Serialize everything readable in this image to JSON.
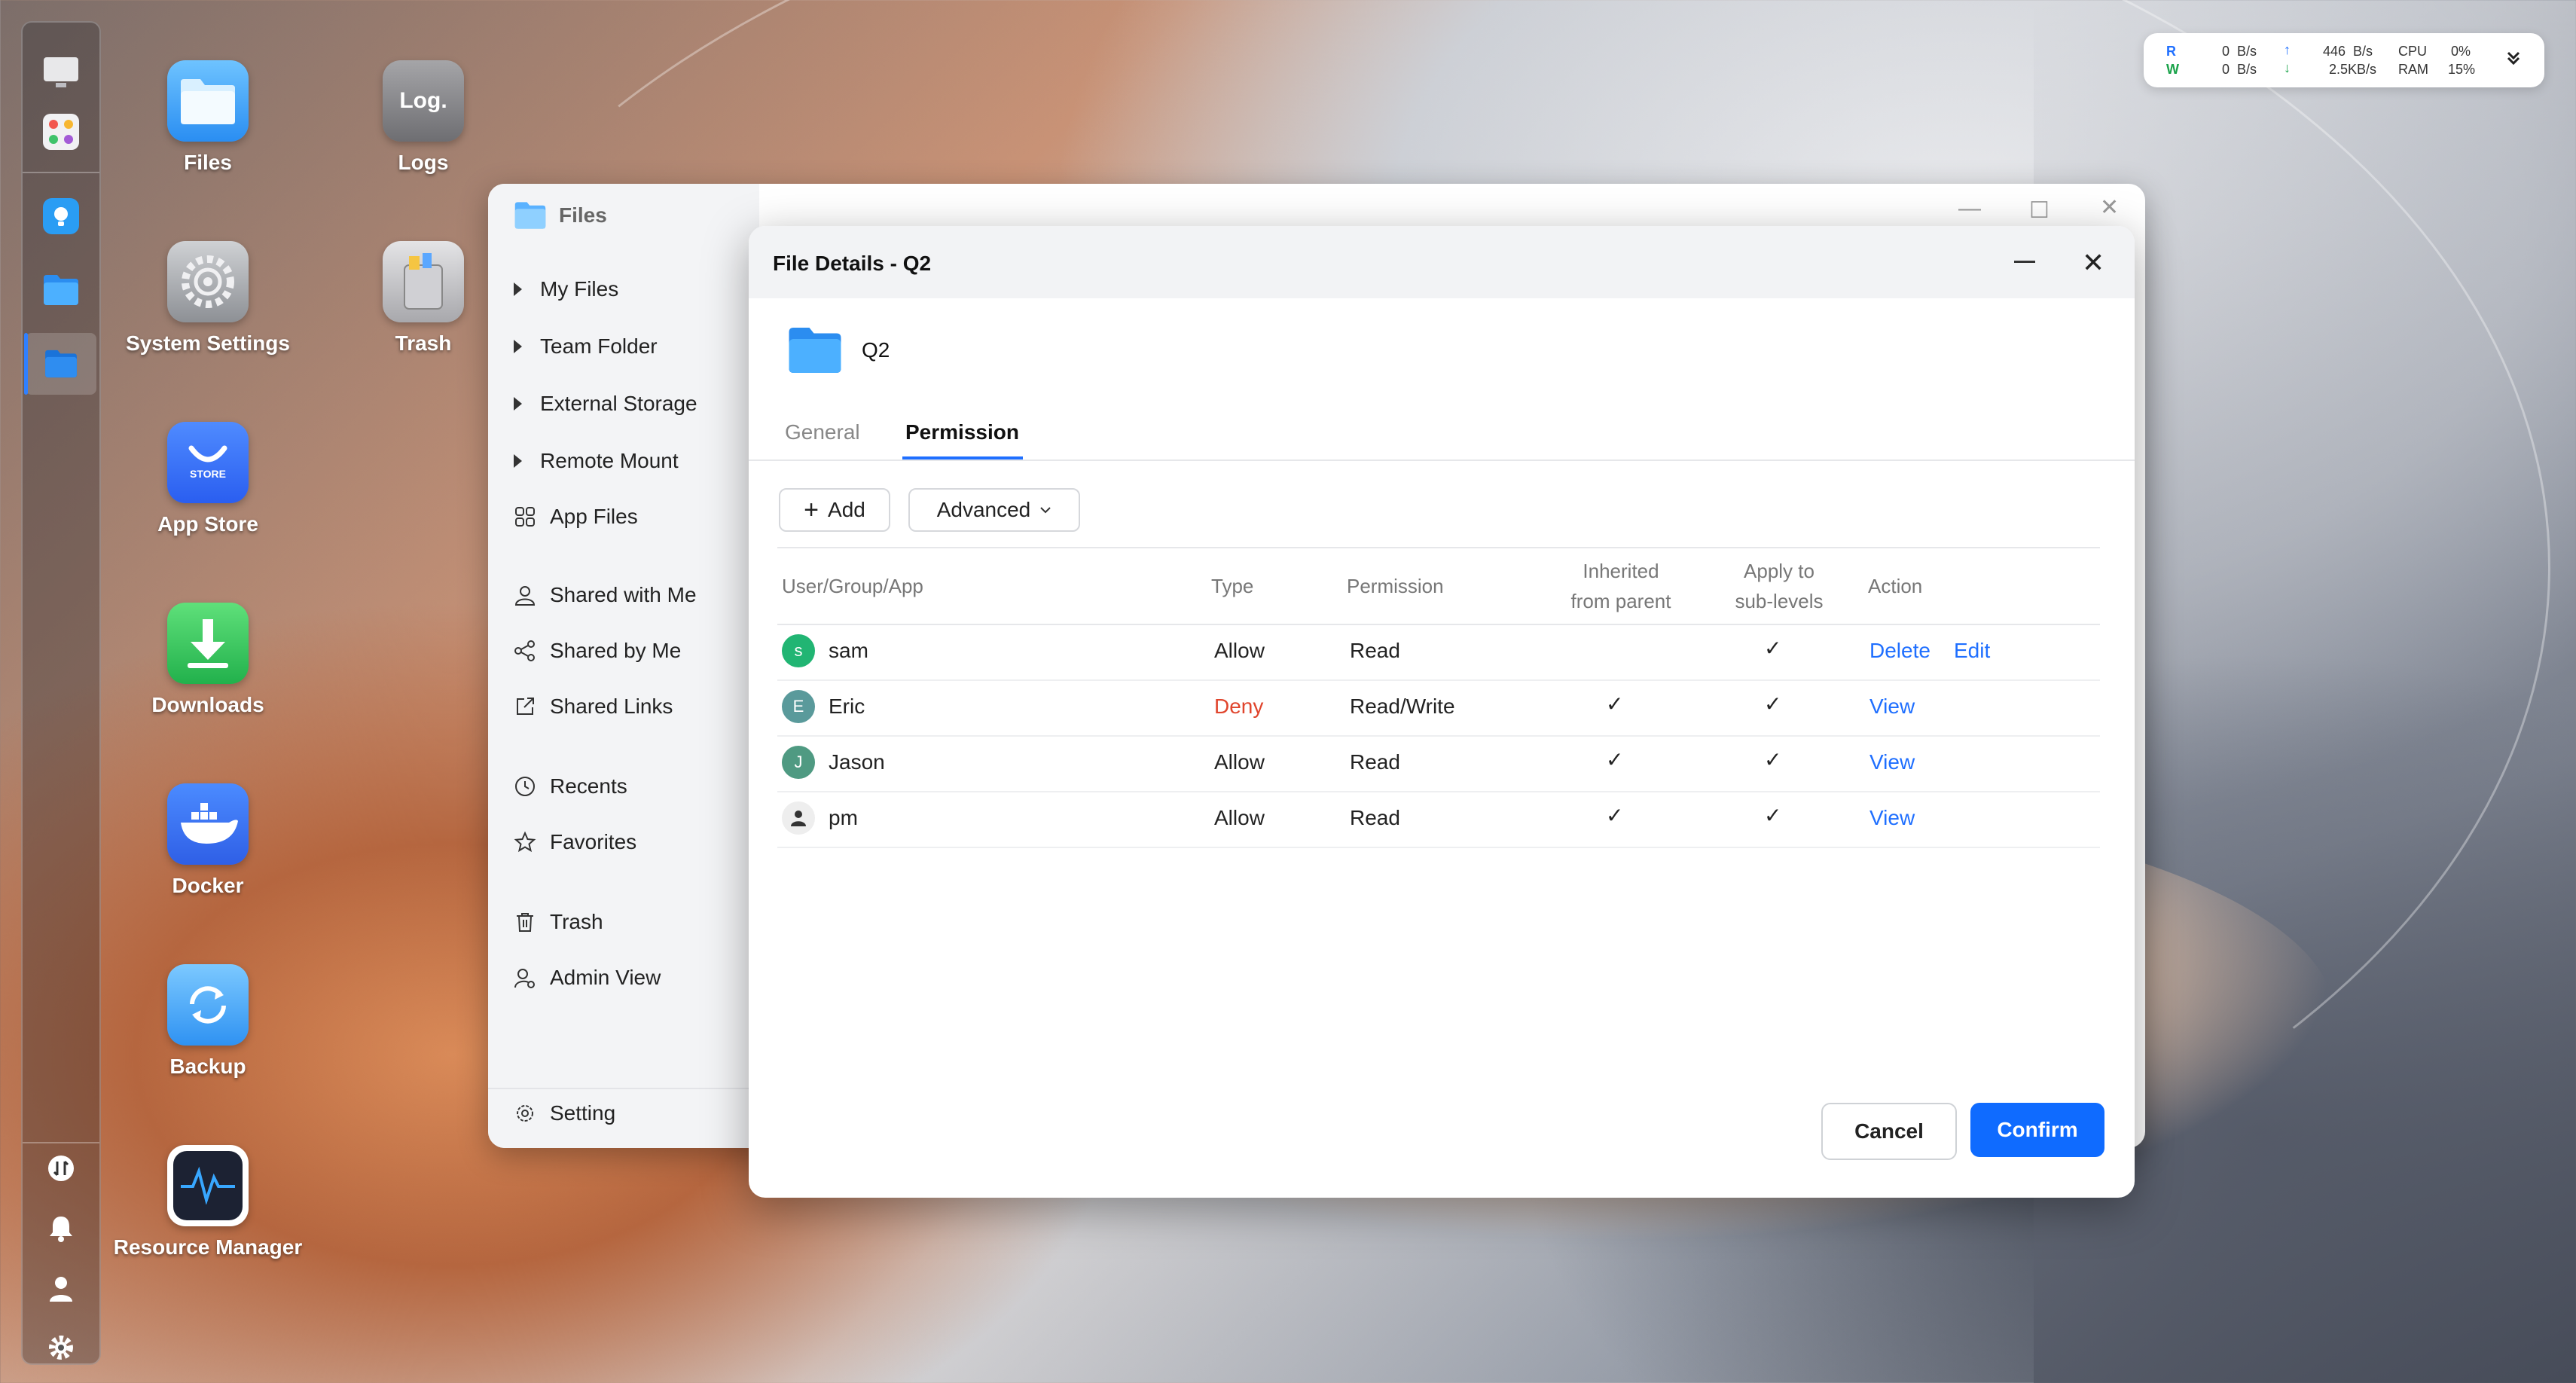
{
  "status": {
    "read_label": "R",
    "write_label": "W",
    "read_rate": "0  B/s",
    "write_rate": "0  B/s",
    "up_rate": "446  B/s",
    "down_rate": "2.5KB/s",
    "cpu_label": "CPU",
    "ram_label": "RAM",
    "cpu_value": "0%",
    "ram_value": "15%",
    "colors": {
      "read": "#1f6fff",
      "write": "#1aa34a"
    }
  },
  "desktop": {
    "icons": [
      {
        "label": "Files",
        "icon": "folder-icon"
      },
      {
        "label": "Logs",
        "icon": "log-icon",
        "glyph": "Log."
      },
      {
        "label": "System Settings",
        "icon": "gear-icon"
      },
      {
        "label": "Trash",
        "icon": "trash-icon"
      },
      {
        "label": "App Store",
        "icon": "store-icon",
        "glyph": "STORE"
      },
      {
        "label": "Downloads",
        "icon": "download-icon"
      },
      {
        "label": "Docker",
        "icon": "docker-icon"
      },
      {
        "label": "Backup",
        "icon": "backup-icon"
      },
      {
        "label": "Resource Manager",
        "icon": "activity-icon"
      }
    ]
  },
  "files_window": {
    "title": "Files",
    "nav": [
      {
        "label": "My Files",
        "icon": "expand-arrow"
      },
      {
        "label": "Team Folder",
        "icon": "expand-arrow"
      },
      {
        "label": "External Storage",
        "icon": "expand-arrow"
      },
      {
        "label": "Remote Mount",
        "icon": "expand-arrow"
      },
      {
        "label": "App Files",
        "icon": "grid-icon"
      },
      {
        "label": "Shared with Me",
        "icon": "user-icon"
      },
      {
        "label": "Shared by Me",
        "icon": "share-icon"
      },
      {
        "label": "Shared Links",
        "icon": "link-out-icon"
      },
      {
        "label": "Recents",
        "icon": "clock-icon"
      },
      {
        "label": "Favorites",
        "icon": "star-icon"
      },
      {
        "label": "Trash",
        "icon": "trash-icon"
      },
      {
        "label": "Admin View",
        "icon": "admin-icon"
      }
    ],
    "setting_label": "Setting"
  },
  "dialog": {
    "title": "File Details - Q2",
    "file_name": "Q2",
    "tabs": [
      "General",
      "Permission"
    ],
    "active_tab": "Permission",
    "add_label": "Add",
    "advanced_label": "Advanced",
    "columns": {
      "user": "User/Group/App",
      "type": "Type",
      "permission": "Permission",
      "inherited_1": "Inherited",
      "inherited_2": "from parent",
      "apply_1": "Apply to",
      "apply_2": "sub-levels",
      "action": "Action"
    },
    "rows": [
      {
        "initial": "s",
        "name": "sam",
        "type": "Allow",
        "permission": "Read",
        "inherited": false,
        "apply": true,
        "actions": [
          "Delete",
          "Edit"
        ],
        "avatar_color": "#21b573"
      },
      {
        "initial": "E",
        "name": "Eric",
        "type": "Deny",
        "permission": "Read/Write",
        "inherited": true,
        "apply": true,
        "actions": [
          "View"
        ],
        "avatar_color": "#5a9a9b"
      },
      {
        "initial": "J",
        "name": "Jason",
        "type": "Allow",
        "permission": "Read",
        "inherited": true,
        "apply": true,
        "actions": [
          "View"
        ],
        "avatar_color": "#4f9a82"
      },
      {
        "initial": "",
        "name": "pm",
        "type": "Allow",
        "permission": "Read",
        "inherited": true,
        "apply": true,
        "actions": [
          "View"
        ],
        "avatar_color": "#eeeeee"
      }
    ],
    "check_glyph": "✓",
    "cancel_label": "Cancel",
    "confirm_label": "Confirm",
    "colors": {
      "accent": "#0f6bff",
      "deny": "#e0452d"
    }
  }
}
